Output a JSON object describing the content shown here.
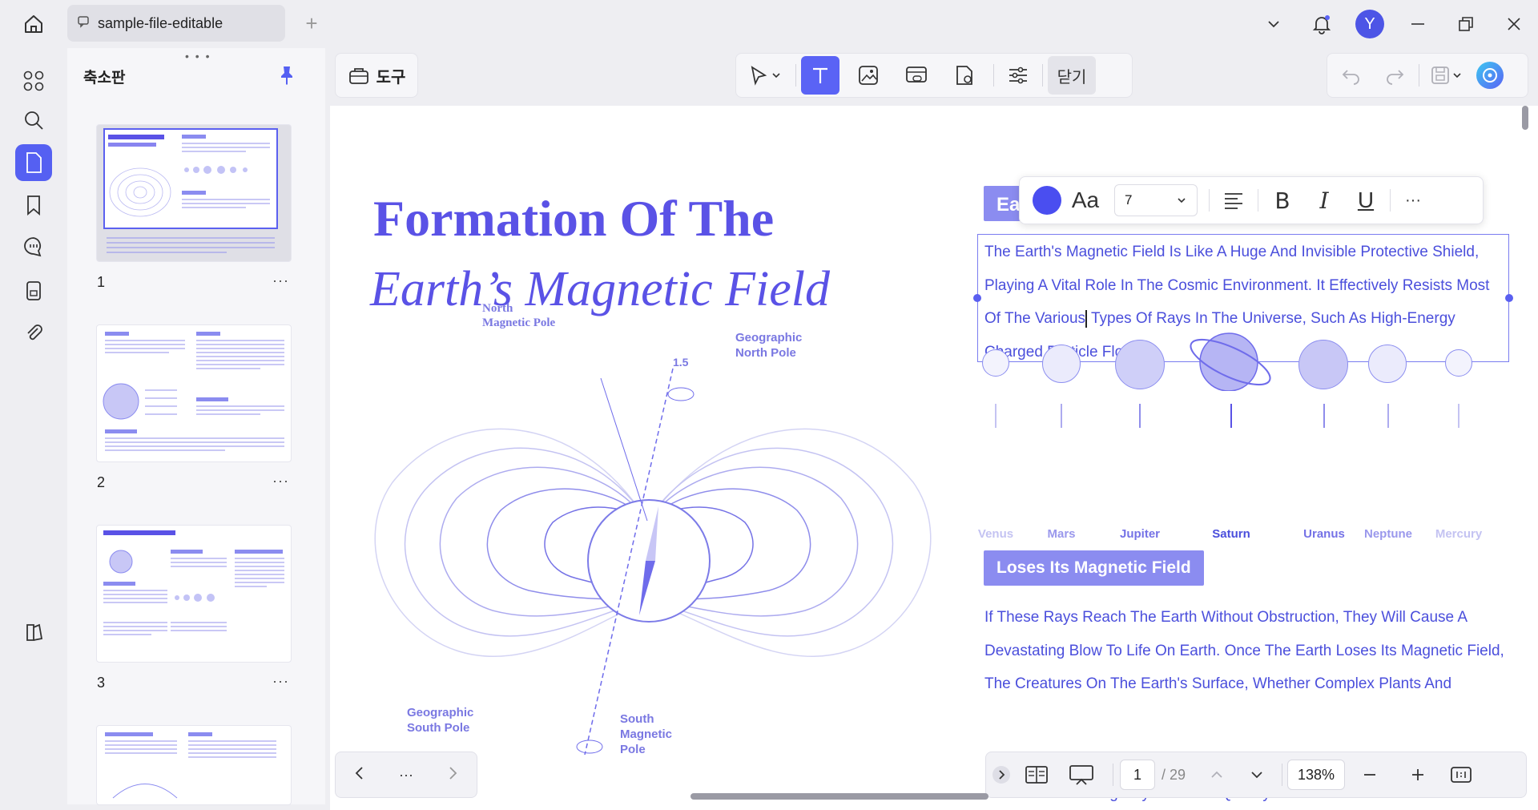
{
  "window": {
    "tab_title": "sample-file-editable",
    "avatar_letter": "Y"
  },
  "sidebar_panel": {
    "title": "축소판",
    "drag_handle": "• • •",
    "pages": [
      {
        "number": "1",
        "more": "···"
      },
      {
        "number": "2",
        "more": "···"
      },
      {
        "number": "3",
        "more": "···"
      }
    ]
  },
  "toolbar": {
    "tools_label": "도구",
    "close_label": "닫기"
  },
  "document": {
    "title_line1": "Formation Of The",
    "title_line2": "Earth’s Magnetic Field",
    "section1_tag": "Ea",
    "section1_text_before_caret": "The Earth's Magnetic Field Is Like A Huge And Invisible Protective Shield, Playing A Vital Role In The Cosmic Environment. It Effectively Resists Most Of The Various",
    "section1_text_after_caret": " Types Of Rays In The Universe, Such As High-Energy Charged Particle Flows.",
    "planets": [
      "Venus",
      "Mars",
      "Jupiter",
      "Saturn",
      "Uranus",
      "Neptune",
      "Mercury"
    ],
    "section2_tag": "Loses Its Magnetic Field",
    "section2_text": "If These Rays Reach The Earth Without Obstruction, They Will Cause A Devastating Blow To Life On Earth. Once The Earth Loses Its Magnetic Field, The Creatures On The Earth's Surface, Whether Complex Plants And",
    "section2_cut_line": "Radiation Of Strong Rays And Will Quickly Go To Extinction.",
    "diagram": {
      "north_magnetic_pole_1": "North",
      "north_magnetic_pole_2": "Magnetic Pole",
      "geographic_north_1": "Geographic",
      "geographic_north_2": "North Pole",
      "angle": "1.5",
      "geographic_south_1": "Geographic",
      "geographic_south_2": "South Pole",
      "south_magnetic_1": "South",
      "south_magnetic_2": "Magnetic",
      "south_magnetic_3": "Pole"
    }
  },
  "format_bar": {
    "font_icon": "Aa",
    "font_size": "7",
    "bold": "B",
    "italic": "I",
    "underline": "U",
    "more": "···"
  },
  "bottom_nav": {
    "more": "···",
    "current_page": "1",
    "total_pages": "/ 29",
    "zoom": "138%"
  },
  "colors": {
    "accent": "#5a63f5",
    "doc_text": "#4b4fdc",
    "tag_bg": "#8b8cf0"
  }
}
